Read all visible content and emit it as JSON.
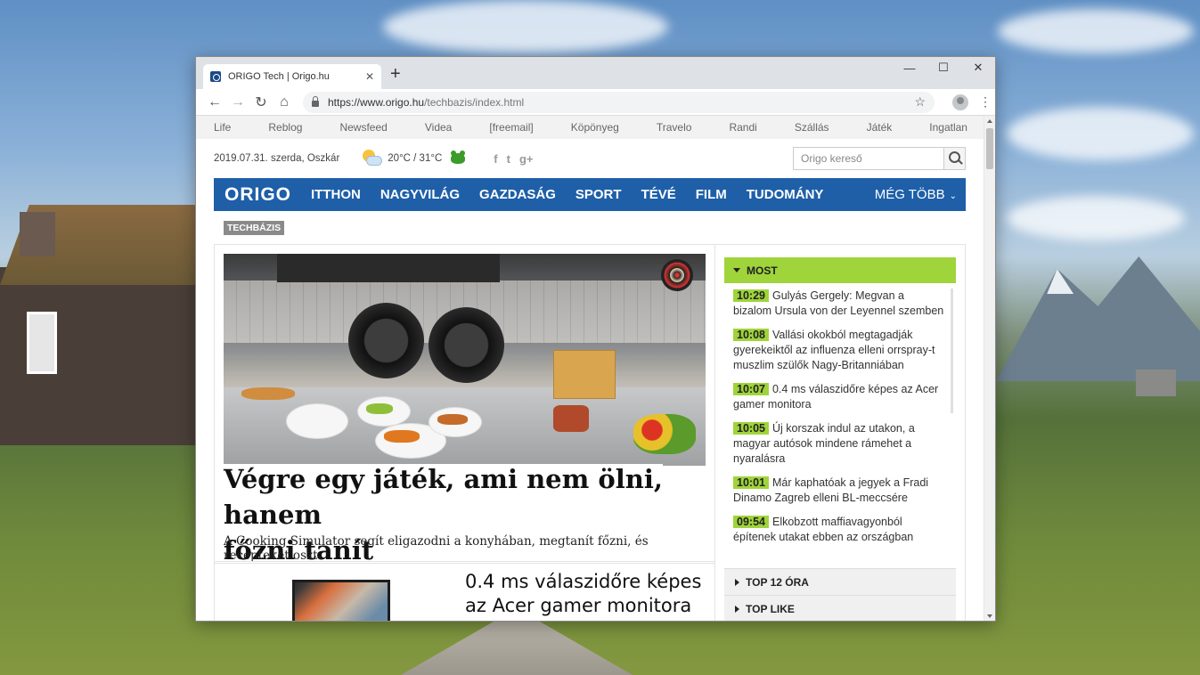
{
  "browser": {
    "tab_title": "ORIGO Tech | Origo.hu",
    "tab_close": "✕",
    "new_tab": "+",
    "minimize": "—",
    "maximize": "☐",
    "close": "✕",
    "back": "←",
    "forward": "→",
    "reload": "↻",
    "home": "⌂",
    "url_host": "https://www.origo.hu",
    "url_path": "/techbazis/index.html",
    "bookmark": "☆",
    "menu": "⋮"
  },
  "partners": [
    "Life",
    "Reblog",
    "Newsfeed",
    "Videa",
    "[freemail]",
    "Köpönyeg",
    "Travelo",
    "Randi",
    "Szállás",
    "Játék",
    "Ingatlan"
  ],
  "topinfo": {
    "date": "2019.07.31. szerda, Oszkár",
    "temperature": "20°C / 31°C",
    "social_facebook": "f",
    "social_twitter": "t",
    "social_google": "g+",
    "search_placeholder": "Origo kereső"
  },
  "nav": {
    "logo": "ORIGO",
    "items": [
      "ITTHON",
      "NAGYVILÁG",
      "GAZDASÁG",
      "SPORT",
      "TÉVÉ",
      "FILM",
      "TUDOMÁNY"
    ],
    "more": "MÉG TÖBB"
  },
  "section_tag": "TECHBÁZIS",
  "hero": {
    "headline_line1": "Végre egy játék, ami nem ölni, hanem",
    "headline_line2": "főzni tanít",
    "lead": "A Cooking Simulator segít eligazodni a konyhában, megtanít főzni, és recepteket oszt."
  },
  "second_article": {
    "title": "0.4 ms válaszidőre képes az Acer gamer monitora"
  },
  "sidebar": {
    "most_title": "MOST",
    "news": [
      {
        "time": "10:29",
        "text": "Gulyás Gergely: Megvan a bizalom Ursula von der Leyennel szemben"
      },
      {
        "time": "10:08",
        "text": "Vallási okokból megtagadják gyerekeiktől az influenza elleni orrspray-t muszlim szülők Nagy-Britanniában"
      },
      {
        "time": "10:07",
        "text": "0.4 ms válaszidőre képes az Acer gamer monitora"
      },
      {
        "time": "10:05",
        "text": "Új korszak indul az utakon, a magyar autósok mindene rámehet a nyaralásra"
      },
      {
        "time": "10:01",
        "text": "Már kaphatóak a jegyek a Fradi Dinamo Zagreb elleni BL-meccsére"
      },
      {
        "time": "09:54",
        "text": "Elkobzott maffiavagyonból építenek utakat ebben az országban"
      }
    ],
    "top12": "TOP 12 ÓRA",
    "toplike": "TOP LIKE"
  }
}
